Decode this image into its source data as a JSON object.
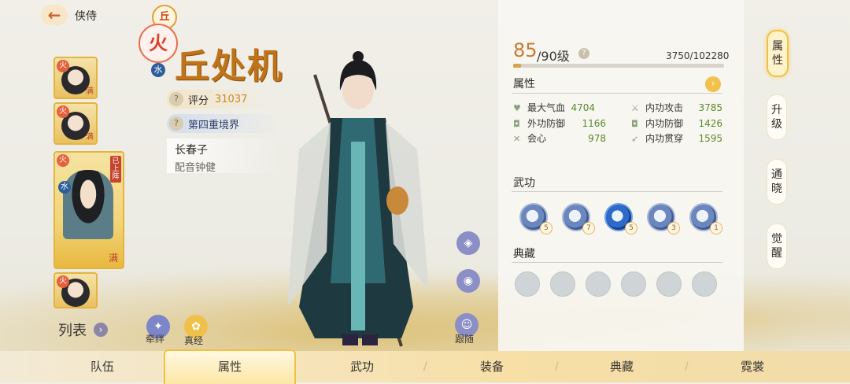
{
  "header": {
    "back_icon": "back-arrow-icon",
    "title": "侠侍",
    "top_badge": "丘"
  },
  "roster": [
    {
      "badge": "火",
      "full_label": "满"
    },
    {
      "badge": "火",
      "full_label": "满"
    },
    {
      "badge": "火",
      "element": "水",
      "status": "已上阵",
      "full_label": "满",
      "selected": true
    },
    {
      "badge": "火"
    }
  ],
  "left_actions": {
    "list_label": "列表",
    "list_arrow": "›",
    "bond_label": "牵绊",
    "truth_label": "真经"
  },
  "hero": {
    "sect_icon": "火",
    "element": "水",
    "name": "丘处机",
    "score_label": "评分",
    "score_value": "31037",
    "realm": "第四重境界",
    "master": "长春子",
    "voice": "配音钟健"
  },
  "figure_actions": {
    "follow_label": "跟随"
  },
  "level": {
    "current": "85",
    "max_text": "/90级",
    "exp": "3750/102280",
    "exp_fraction": 0.037
  },
  "attributes": {
    "title": "属性",
    "stats": [
      {
        "icon": "heart-icon",
        "label": "最大气血",
        "value": "4704"
      },
      {
        "icon": "sword-icon",
        "label": "内功攻击",
        "value": "3785"
      },
      {
        "icon": "armor-icon",
        "label": "外功防御",
        "value": "1166"
      },
      {
        "icon": "armor-icon",
        "label": "内功防御",
        "value": "1426"
      },
      {
        "icon": "crit-icon",
        "label": "会心",
        "value": "978"
      },
      {
        "icon": "pierce-icon",
        "label": "内功贯穿",
        "value": "1595"
      }
    ]
  },
  "martial": {
    "title": "武功",
    "skills": [
      {
        "level": "5"
      },
      {
        "level": "7"
      },
      {
        "level": "5",
        "highlight": true
      },
      {
        "level": "3"
      },
      {
        "level": "1"
      }
    ]
  },
  "collection": {
    "title": "典藏",
    "count": 6
  },
  "side_tabs": [
    {
      "label": "属性",
      "active": true
    },
    {
      "label": "升级"
    },
    {
      "label": "通晓"
    },
    {
      "label": "觉醒"
    }
  ],
  "bottom_tabs": [
    {
      "label": "队伍"
    },
    {
      "label": "属性",
      "active": true
    },
    {
      "label": "武功"
    },
    {
      "label": "装备"
    },
    {
      "label": "典藏"
    },
    {
      "label": "霓裳"
    }
  ],
  "colors": {
    "accent": "#f0c244",
    "name": "#c0741a",
    "stat_value": "#5a8a2a"
  }
}
